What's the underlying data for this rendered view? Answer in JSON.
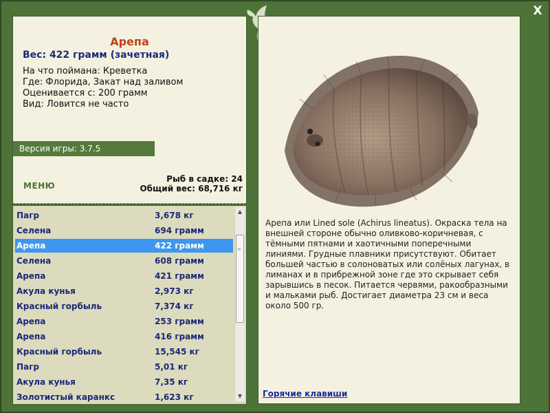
{
  "window": {
    "close_label": "X"
  },
  "fish": {
    "title": "Арепа",
    "weight_line": "Вес: 422 грамм (зачетная)",
    "details": [
      "На что поймана: Креветка",
      "Где: Флорида, Закат над заливом",
      "Оценивается с: 200 грамм",
      "Вид: Ловится не часто"
    ],
    "description": "Арепа или Lined sole (Achirus lineatus). Окраска тела на внешней стороне обычно оливково-коричневая, с тёмными пятнами и хаотичными поперечными линиями. Грудные плавники присутствуют. Обитает большей частью в солоноватых или солёных лагунах, в лиманах и в прибрежной зоне где это скрывает себя зарывшись в песок. Питается червями, ракообразными и мальками рыб. Достигает диаметра 23 см и веса около 500 гр."
  },
  "version": "Версия игры: 3.7.5",
  "menu_label": "МЕНЮ",
  "stats": {
    "fish_in_cage": "Рыб в садке: 24",
    "total_weight": "Общий вес: 68,716 кг"
  },
  "catch_list": [
    {
      "name": "Пагр",
      "weight": "3,678 кг",
      "selected": false
    },
    {
      "name": "Селена",
      "weight": "694 грамм",
      "selected": false
    },
    {
      "name": "Арепа",
      "weight": "422 грамм",
      "selected": true
    },
    {
      "name": "Селена",
      "weight": "608 грамм",
      "selected": false
    },
    {
      "name": "Арепа",
      "weight": "421 грамм",
      "selected": false
    },
    {
      "name": "Акула кунья",
      "weight": "2,973 кг",
      "selected": false
    },
    {
      "name": "Красный горбыль",
      "weight": "7,374 кг",
      "selected": false
    },
    {
      "name": "Арепа",
      "weight": "253 грамм",
      "selected": false
    },
    {
      "name": "Арепа",
      "weight": "416 грамм",
      "selected": false
    },
    {
      "name": "Красный горбыль",
      "weight": "15,545 кг",
      "selected": false
    },
    {
      "name": "Пагр",
      "weight": "5,01 кг",
      "selected": false
    },
    {
      "name": "Акула кунья",
      "weight": "7,35 кг",
      "selected": false
    },
    {
      "name": "Золотистый каранкс",
      "weight": "1,623 кг",
      "selected": false
    }
  ],
  "hotkeys_label": "Горячие клавиши",
  "colors": {
    "frame": "#4d7338",
    "panel": "#f4f1e0",
    "list_bg": "#dcdbbd",
    "selected_row": "#3e97ee",
    "title": "#c1421a",
    "list_text": "#1a2878"
  }
}
